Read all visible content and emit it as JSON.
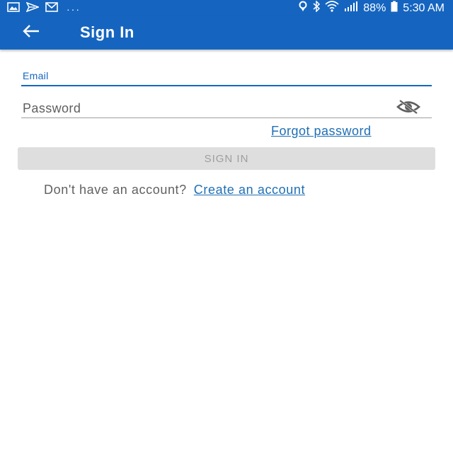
{
  "status_bar": {
    "battery_level": "88%",
    "time": "5:30 AM",
    "notification_icons": [
      "image-icon",
      "send-icon",
      "mail-icon"
    ],
    "overflow_indicator": "···",
    "system_icons": [
      "location-icon",
      "bluetooth-icon",
      "wifi-icon",
      "signal-icon",
      "battery-icon"
    ]
  },
  "app_bar": {
    "title": "Sign In",
    "back_icon": "back-arrow-icon"
  },
  "form": {
    "email_label": "Email",
    "email_value": "",
    "password_placeholder": "Password",
    "password_visibility_icon": "eye-off-icon",
    "forgot_password": "Forgot password",
    "sign_in_button": "SIGN IN",
    "no_account_prompt": "Don't have an account?",
    "create_account": "Create an account"
  },
  "colors": {
    "primary": "#1565c0",
    "link": "#1e6fb5",
    "button_disabled_bg": "#dedede",
    "button_disabled_text": "#9e9e9e"
  }
}
